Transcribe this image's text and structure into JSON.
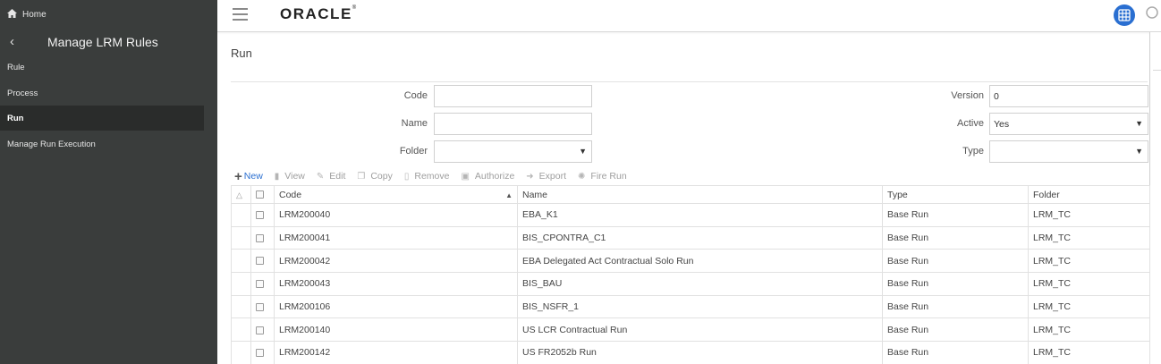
{
  "sidebar": {
    "home_label": "Home",
    "title": "Manage LRM Rules",
    "items": [
      {
        "label": "Rule"
      },
      {
        "label": "Process"
      },
      {
        "label": "Run"
      },
      {
        "label": "Manage Run Execution"
      }
    ]
  },
  "header": {
    "logo_text": "ORACLE",
    "logo_mark": "®"
  },
  "page": {
    "title": "Run"
  },
  "form": {
    "code_label": "Code",
    "code_value": "",
    "name_label": "Name",
    "name_value": "",
    "folder_label": "Folder",
    "folder_value": "",
    "version_label": "Version",
    "version_value": "0",
    "active_label": "Active",
    "active_value": "Yes",
    "type_label": "Type",
    "type_value": ""
  },
  "toolbar": {
    "new": "New",
    "view": "View",
    "edit": "Edit",
    "copy": "Copy",
    "remove": "Remove",
    "authorize": "Authorize",
    "export": "Export",
    "fire_run": "Fire Run"
  },
  "table": {
    "columns": [
      "Code",
      "Name",
      "Type",
      "Folder"
    ],
    "rows": [
      {
        "code": "LRM200040",
        "name": "EBA_K1",
        "type": "Base Run",
        "folder": "LRM_TC"
      },
      {
        "code": "LRM200041",
        "name": "BIS_CPONTRA_C1",
        "type": "Base Run",
        "folder": "LRM_TC"
      },
      {
        "code": "LRM200042",
        "name": "EBA Delegated Act Contractual Solo Run",
        "type": "Base Run",
        "folder": "LRM_TC"
      },
      {
        "code": "LRM200043",
        "name": "BIS_BAU",
        "type": "Base Run",
        "folder": "LRM_TC"
      },
      {
        "code": "LRM200106",
        "name": "BIS_NSFR_1",
        "type": "Base Run",
        "folder": "LRM_TC"
      },
      {
        "code": "LRM200140",
        "name": "US LCR Contractual Run",
        "type": "Base Run",
        "folder": "LRM_TC"
      },
      {
        "code": "LRM200142",
        "name": "US FR2052b Run",
        "type": "Base Run",
        "folder": "LRM_TC"
      }
    ]
  },
  "colors": {
    "sidebar_bg": "#3a3d3c",
    "sidebar_active_bg": "#2a2c2b",
    "accent": "#2a6fd1"
  }
}
